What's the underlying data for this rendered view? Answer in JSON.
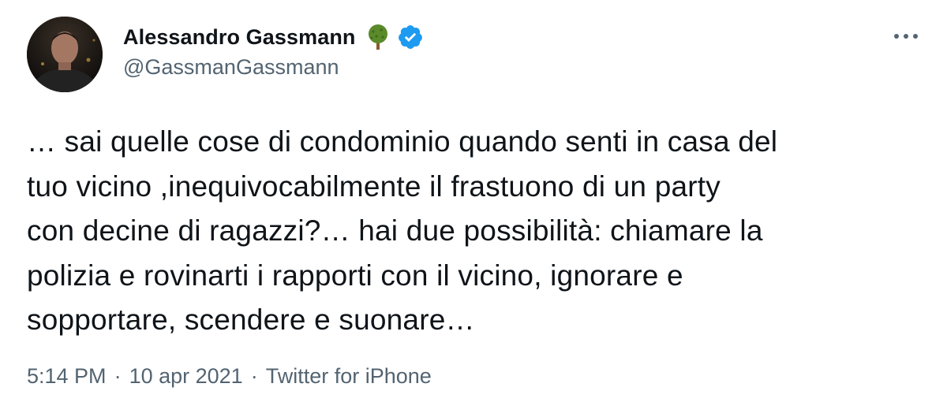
{
  "author": {
    "display_name": "Alessandro Gassmann",
    "handle": "@GassmanGassmann",
    "avatar_icon": "profile-photo",
    "badges": [
      "tree-emoji-icon",
      "verified-badge-icon"
    ]
  },
  "menu": {
    "icon": "more-options-icon"
  },
  "tweet": {
    "text": "… sai quelle cose di condominio quando senti in casa del\ntuo vicino ,inequivocabilmente il frastuono di un party\ncon decine di ragazzi?… hai due possibilità: chiamare la\npolizia e rovinarti i rapporti con il vicino, ignorare e\nsopportare, scendere e suonare…"
  },
  "meta": {
    "time": "5:14 PM",
    "separator": "·",
    "date": "10 apr 2021",
    "source": "Twitter for iPhone"
  },
  "colors": {
    "text": "#0f1419",
    "secondary": "#536471",
    "verified": "#1d9bf0",
    "tree_green": "#5b8a2b"
  }
}
